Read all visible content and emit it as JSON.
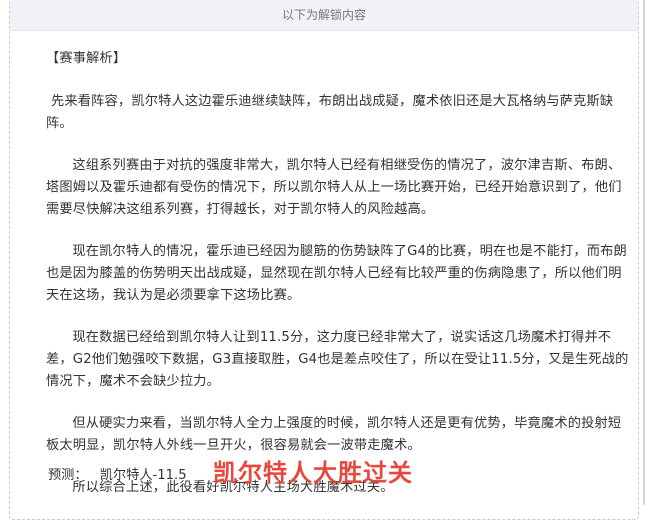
{
  "header": {
    "title": "以下为解锁内容"
  },
  "article": {
    "section_title": "【赛事解析】",
    "paragraphs": [
      "先来看阵容，凯尔特人这边霍乐迪继续缺阵，布朗出战成疑，魔术依旧还是大瓦格纳与萨克斯缺阵。",
      "这组系列赛由于对抗的强度非常大，凯尔特人已经有相继受伤的情况了，波尔津吉斯、布朗、塔图姆以及霍乐迪都有受伤的情况下，所以凯尔特人从上一场比赛开始，已经开始意识到了，他们需要尽快解决这组系列赛，打得越长，对于凯尔特人的风险越高。",
      "现在凯尔特人的情况，霍乐迪已经因为腿筋的伤势缺阵了G4的比赛，明在也是不能打，而布朗也是因为膝盖的伤势明天出战成疑，显然现在凯尔特人已经有比较严重的伤病隐患了，所以他们明天在这场，我认为是必须要拿下这场比赛。",
      "现在数据已经给到凯尔特人让到11.5分，这力度已经非常大了，说实话这几场魔术打得并不差，G2他们勉强咬下数据，G3直接取胜，G4也是差点咬住了，所以在受让11.5分，又是生死战的情况下，魔术不会缺少拉力。",
      "但从硬实力来看，当凯尔特人全力上强度的时候，凯尔特人还是更有优势，毕竟魔术的投射短板太明显，凯尔特人外线一旦开火，很容易就会一波带走魔术。",
      "所以综合上述，此役看好凯尔特人主场大胜魔术过关。"
    ]
  },
  "prediction": {
    "label": "预测：",
    "value": "凯尔特人-11.5",
    "verdict": "凯尔特人大胜过关"
  },
  "colors": {
    "verdict": "#e8473d",
    "header_bg": "#f2f1f8",
    "text": "#333333"
  }
}
